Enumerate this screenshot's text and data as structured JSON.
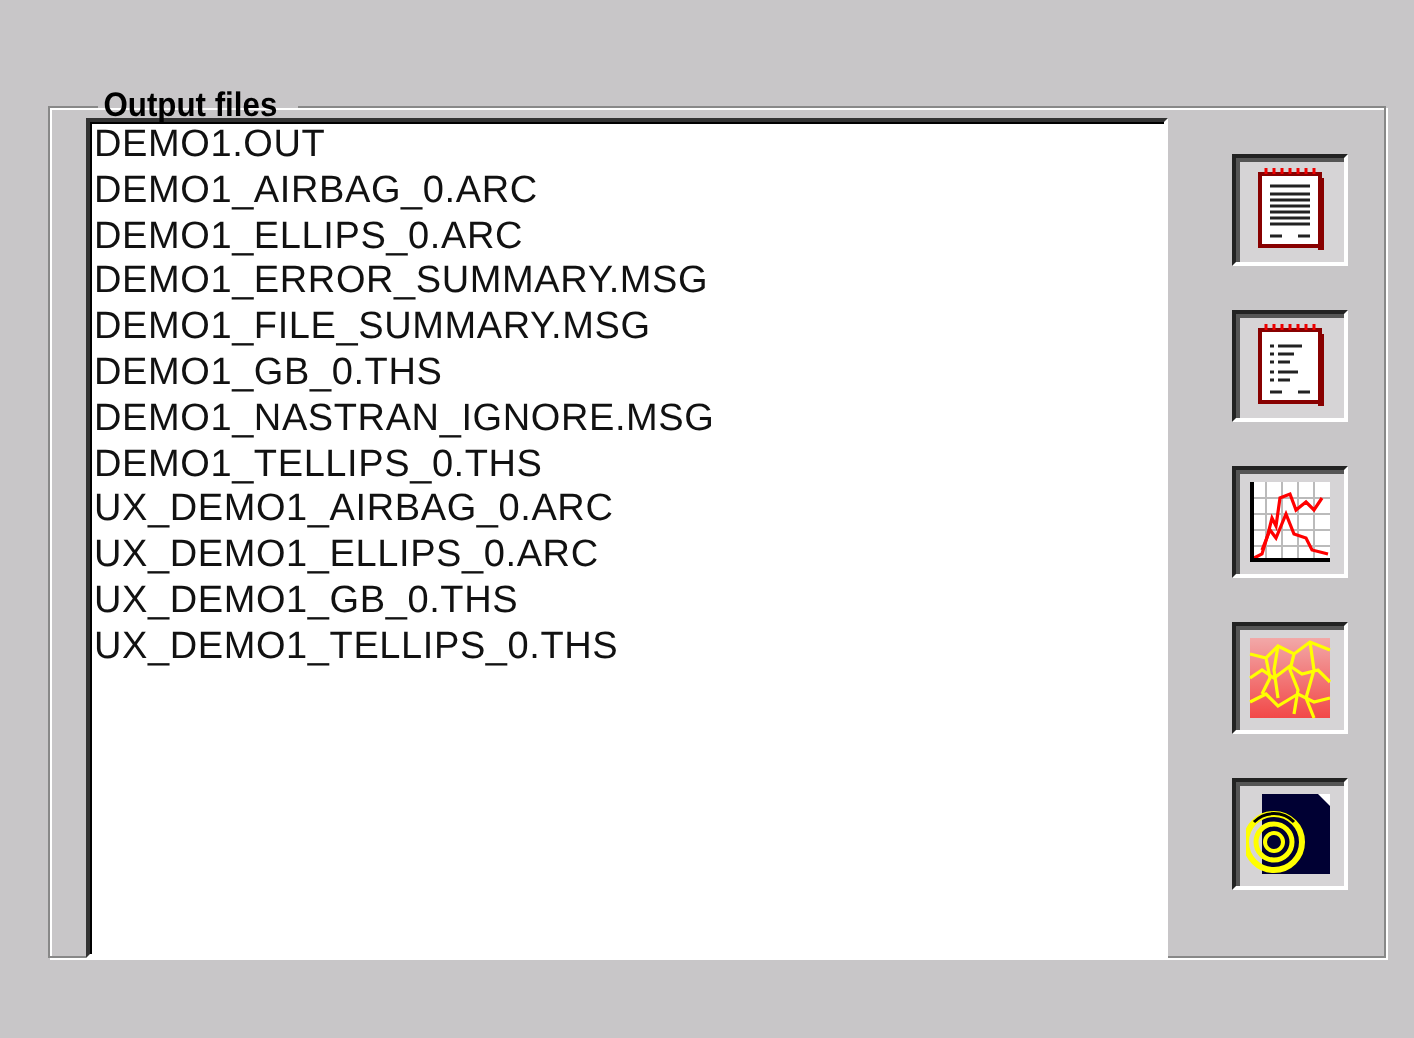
{
  "group": {
    "title": "Output files"
  },
  "files": [
    {
      "name": "DEMO1.OUT"
    },
    {
      "name": "DEMO1_AIRBAG_0.ARC"
    },
    {
      "name": "DEMO1_ELLIPS_0.ARC"
    },
    {
      "name": "DEMO1_ERROR_SUMMARY.MSG"
    },
    {
      "name": "DEMO1_FILE_SUMMARY.MSG"
    },
    {
      "name": "DEMO1_GB_0.THS"
    },
    {
      "name": "DEMO1_NASTRAN_IGNORE.MSG"
    },
    {
      "name": "DEMO1_TELLIPS_0.THS"
    },
    {
      "name": "UX_DEMO1_AIRBAG_0.ARC"
    },
    {
      "name": "UX_DEMO1_ELLIPS_0.ARC"
    },
    {
      "name": "UX_DEMO1_GB_0.THS"
    },
    {
      "name": "UX_DEMO1_TELLIPS_0.THS"
    }
  ],
  "tool_buttons": [
    {
      "kind": "table"
    },
    {
      "kind": "notes"
    },
    {
      "kind": "graph"
    },
    {
      "kind": "contour"
    },
    {
      "kind": "rings"
    }
  ]
}
